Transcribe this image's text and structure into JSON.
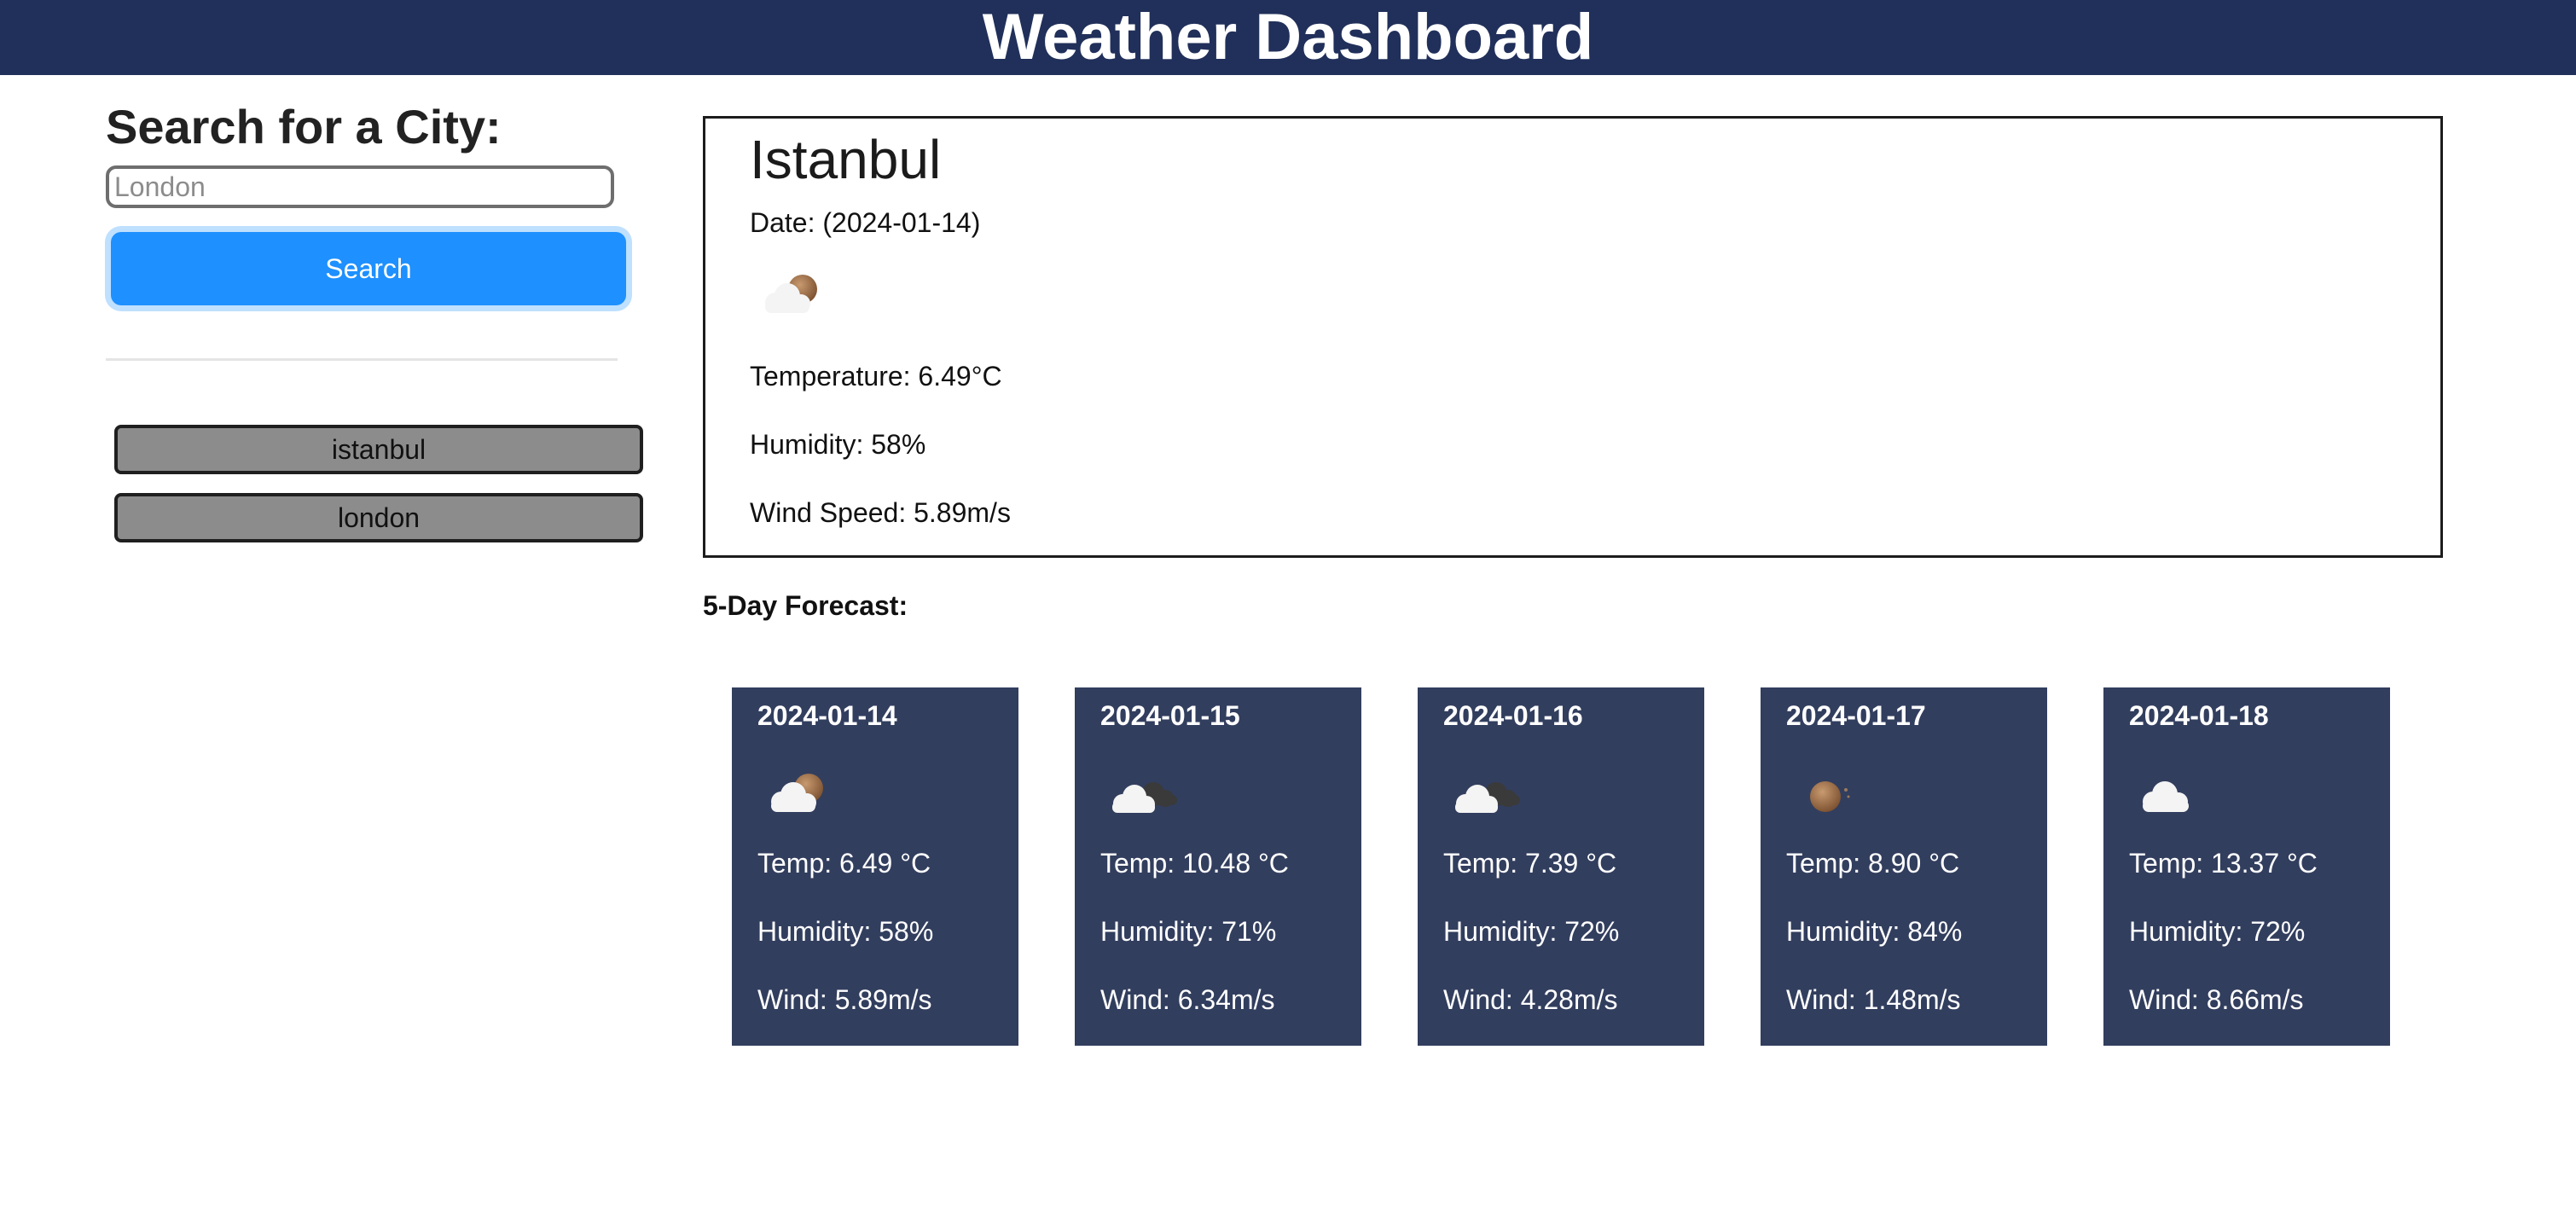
{
  "header": {
    "title": "Weather Dashboard",
    "background": "#21305a"
  },
  "sidebar": {
    "heading": "Search for a City:",
    "search": {
      "placeholder": "London",
      "value": ""
    },
    "search_button": "Search",
    "history": [
      "istanbul",
      "london"
    ]
  },
  "current": {
    "city": "Istanbul",
    "date": "Date: (2024-01-14)",
    "icon": "cloud-moon-icon",
    "temperature": "Temperature: 6.49°C",
    "humidity": "Humidity: 58%",
    "wind": "Wind Speed: 5.89m/s"
  },
  "forecast": {
    "title": "5-Day Forecast:",
    "card_color": "#323e5e",
    "days": [
      {
        "date": "2024-01-14",
        "icon": "cloud-moon-icon",
        "temp": "Temp: 6.49 °C",
        "humidity": "Humidity: 58%",
        "wind": "Wind: 5.89m/s"
      },
      {
        "date": "2024-01-15",
        "icon": "cloud-dark-cloud-icon",
        "temp": "Temp: 10.48 °C",
        "humidity": "Humidity: 71%",
        "wind": "Wind: 6.34m/s"
      },
      {
        "date": "2024-01-16",
        "icon": "cloud-dark-cloud-icon",
        "temp": "Temp: 7.39 °C",
        "humidity": "Humidity: 72%",
        "wind": "Wind: 4.28m/s"
      },
      {
        "date": "2024-01-17",
        "icon": "moon-icon",
        "temp": "Temp: 8.90 °C",
        "humidity": "Humidity: 84%",
        "wind": "Wind: 1.48m/s"
      },
      {
        "date": "2024-01-18",
        "icon": "cloud-icon",
        "temp": "Temp: 13.37 °C",
        "humidity": "Humidity: 72%",
        "wind": "Wind: 8.66m/s"
      }
    ]
  }
}
